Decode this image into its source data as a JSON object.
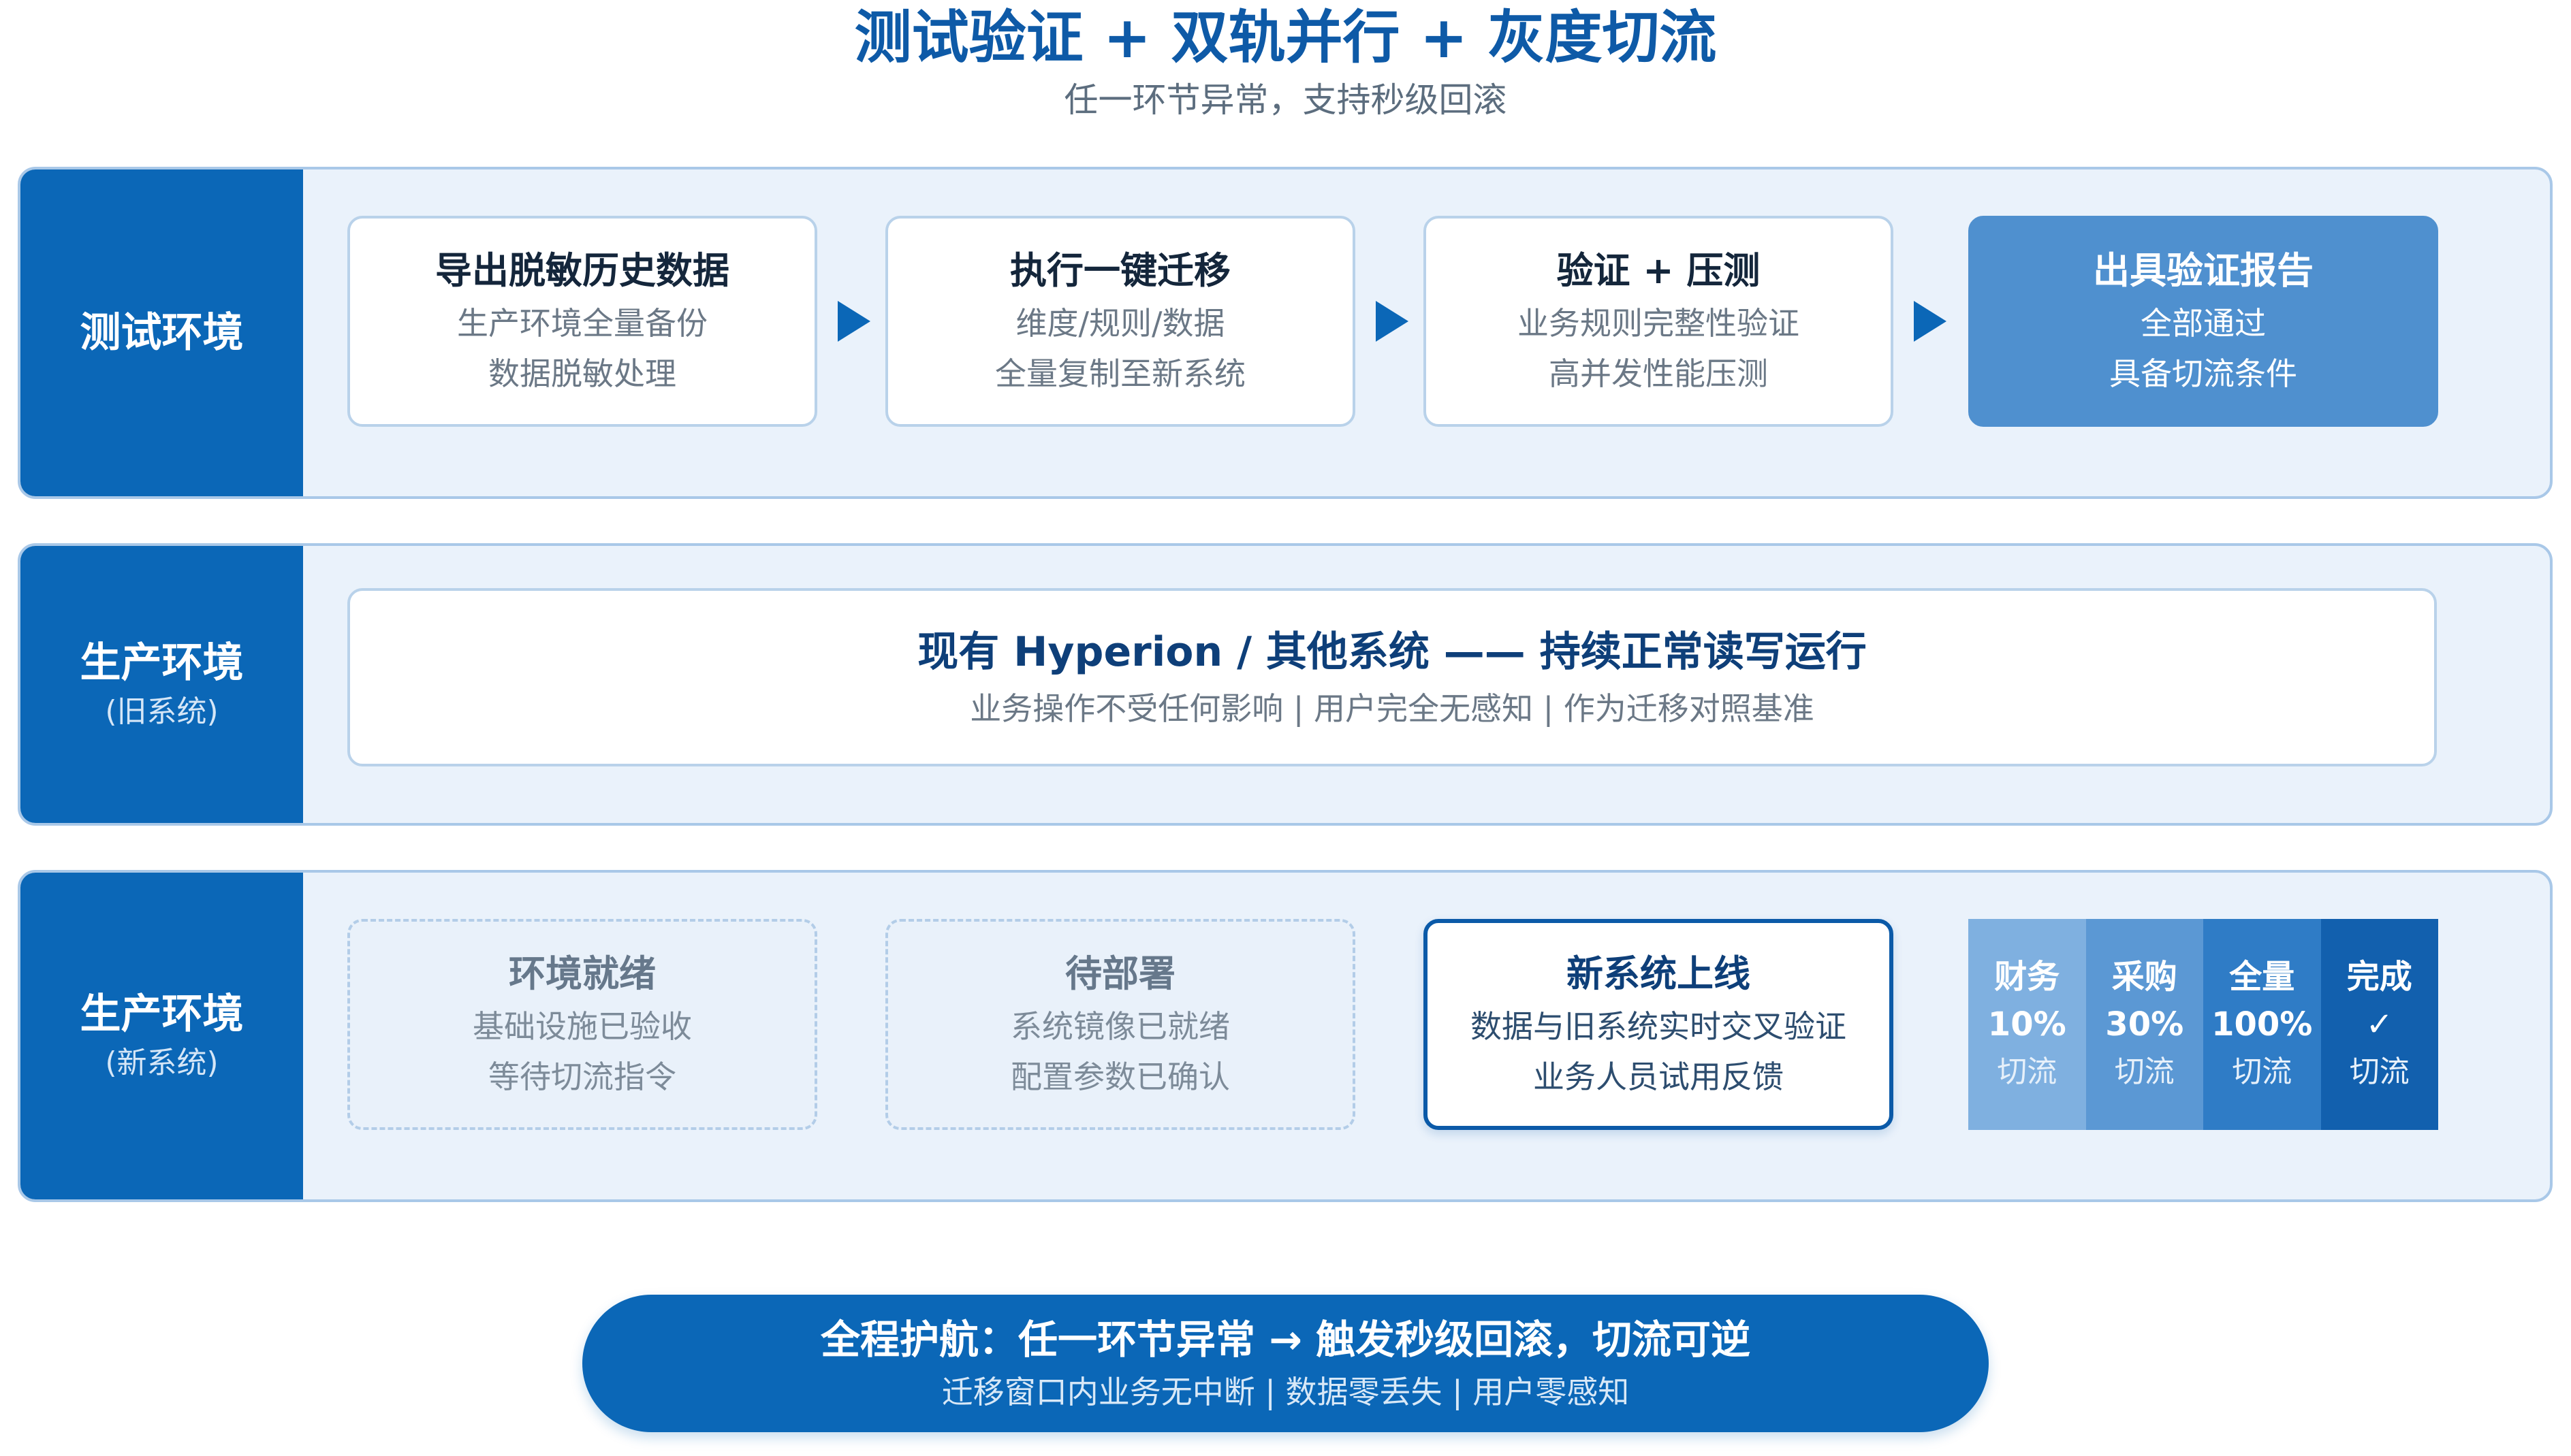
{
  "header": {
    "title": "测试验证 + 双轨并行 + 灰度切流",
    "subtitle": "任一环节异常，支持秒级回滚"
  },
  "rows": {
    "test": {
      "label": "测试环境",
      "steps": [
        {
          "title": "导出脱敏历史数据",
          "lines": [
            "生产环境全量备份",
            "数据脱敏处理"
          ]
        },
        {
          "title": "执行一键迁移",
          "lines": [
            "维度/规则/数据",
            "全量复制至新系统"
          ]
        },
        {
          "title": "验证 + 压测",
          "lines": [
            "业务规则完整性验证",
            "高并发性能压测"
          ]
        },
        {
          "title": "出具验证报告",
          "lines": [
            "全部通过",
            "具备切流条件"
          ]
        }
      ]
    },
    "prod_old": {
      "label": "生产环境",
      "sublabel": "(旧系统)",
      "title": "现有 Hyperion / 其他系统 —— 持续正常读写运行",
      "subtitle": "业务操作不受任何影响 | 用户完全无感知 | 作为迁移对照基准"
    },
    "prod_new": {
      "label": "生产环境",
      "sublabel": "(新系统)",
      "steps": [
        {
          "title": "环境就绪",
          "lines": [
            "基础设施已验收",
            "等待切流指令"
          ]
        },
        {
          "title": "待部署",
          "lines": [
            "系统镜像已就绪",
            "配置参数已确认"
          ]
        },
        {
          "title": "新系统上线",
          "lines": [
            "数据与旧系统实时交叉验证",
            "业务人员试用反馈"
          ]
        }
      ],
      "stages": [
        {
          "name": "财务",
          "value": "10%",
          "action": "切流",
          "color": "#7fb0e0"
        },
        {
          "name": "采购",
          "value": "30%",
          "action": "切流",
          "color": "#5b98d4"
        },
        {
          "name": "全量",
          "value": "100%",
          "action": "切流",
          "color": "#2f7cc6"
        },
        {
          "name": "完成",
          "value": "✓",
          "action": "切流",
          "color": "#1260ae"
        }
      ]
    }
  },
  "banner": {
    "title": "全程护航：任一环节异常 → 触发秒级回滚，切流可逆",
    "subtitle": "迁移窗口内业务无中断 | 数据零丢失 | 用户零感知"
  },
  "colors": {
    "primary": "#0b67b7",
    "title": "#0e5aa7",
    "row_background": "#eaf2fb",
    "row_border": "#a9c8e8",
    "highlight_card": "#4f90cf"
  }
}
